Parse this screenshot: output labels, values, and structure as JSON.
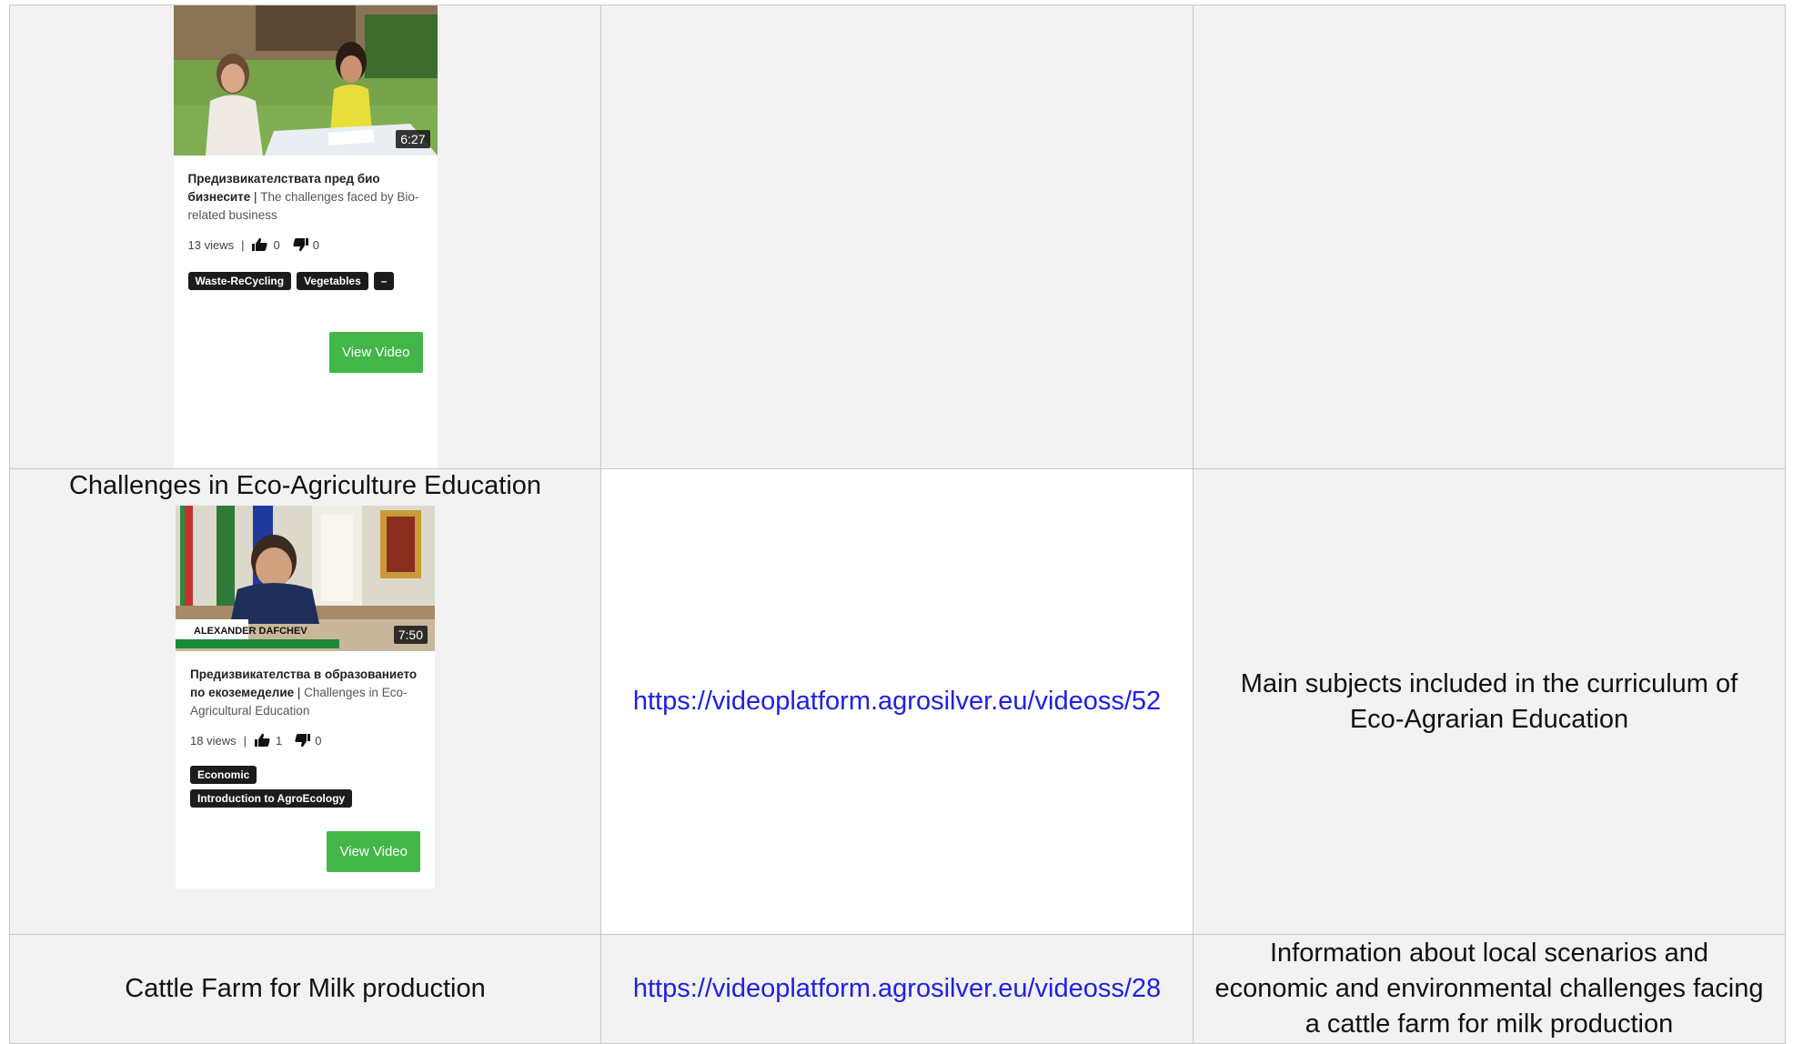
{
  "rows": [
    {
      "card": {
        "duration": "6:27",
        "title_bg": "Предизвикателствата пред био бизнесите",
        "title_sep": " | ",
        "title_en": "The challenges faced by Bio-related business",
        "views": "13 views",
        "likes": "0",
        "dislikes": "0",
        "tags": [
          "Waste-ReCycling",
          "Vegetables",
          "–"
        ],
        "button": "View Video"
      }
    },
    {
      "title": "Challenges in Eco-Agriculture Education",
      "card": {
        "duration": "7:50",
        "overlay_name": "ALEXANDER DAFCHEV",
        "title_bg": "Предизвикателства в образованието по екоземеделие",
        "title_sep": " | ",
        "title_en": "Challenges in Eco-Agricultural Education",
        "views": "18 views",
        "likes": "1",
        "dislikes": "0",
        "tags": [
          "Economic",
          "Introduction to AgroEcology"
        ],
        "button": "View Video"
      },
      "link": "https://videoplatform.agrosilver.eu/videoss/52",
      "description": "Main subjects included in the curriculum of Eco-Agrarian Education"
    },
    {
      "title": "Cattle Farm for Milk production",
      "link": "https://videoplatform.agrosilver.eu/videoss/28",
      "description": "Information about local scenarios and economic and environmental challenges facing a cattle farm for milk production"
    }
  ],
  "colors": {
    "link": "#1f1fe6",
    "button": "#43b64a",
    "tag": "#1c1c1c",
    "cell_grey": "#f2f2f2"
  },
  "icons": [
    "thumbs-up-icon",
    "thumbs-down-icon"
  ]
}
